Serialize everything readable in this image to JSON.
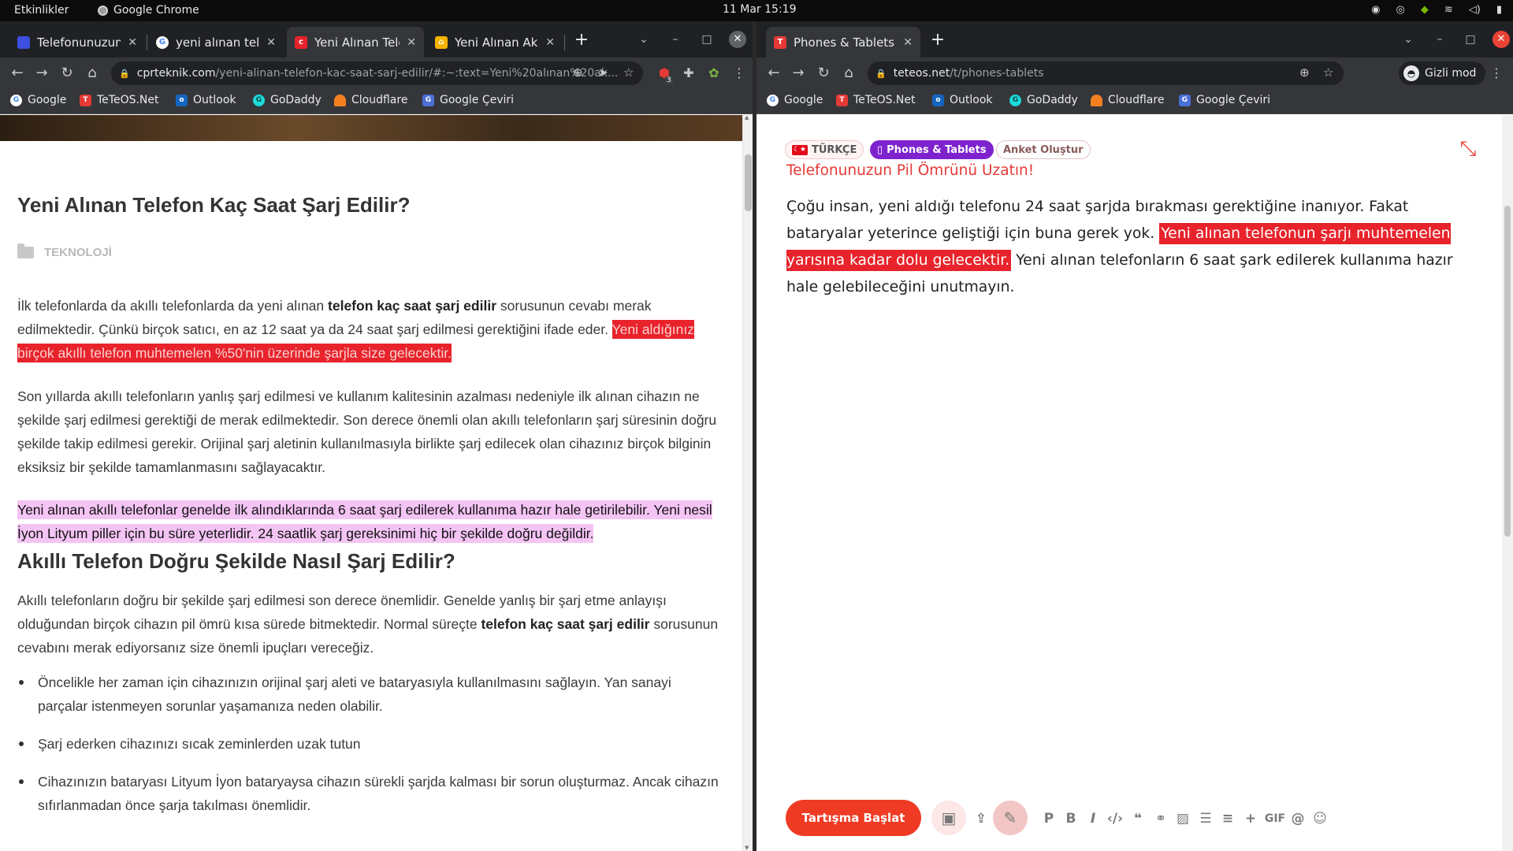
{
  "system": {
    "activities": "Etkinlikler",
    "app_name": "Google Chrome",
    "clock": "11 Mar  15:19"
  },
  "left_window": {
    "tabs": [
      {
        "title": "Telefonunuzun P",
        "favicon_color": "#3c4fe0"
      },
      {
        "title": "yeni alınan telefo",
        "favicon_color": "#4285f4"
      },
      {
        "title": "Yeni Alınan Telef",
        "favicon_color": "#e8232b"
      },
      {
        "title": "Yeni Alınan Akıll",
        "favicon_color": "#f4b400"
      }
    ],
    "url_host": "cprteknik.com",
    "url_path": "/yeni-alinan-telefon-kac-saat-sarj-edilir/#:~:text=Yeni%20alınan%20ak...",
    "extension_badge": "3",
    "article": {
      "title": "Yeni Alınan Telefon Kaç Saat Şarj Edilir?",
      "category": "TEKNOLOJİ",
      "p1_a": "İlk telefonlarda da akıllı telefonlarda da yeni alınan ",
      "p1_bold": "telefon kaç saat şarj edilir",
      "p1_b": " sorusunun cevabı merak edilmektedir. Çünkü birçok satıcı, en az 12 saat ya da 24 saat şarj edilmesi gerektiğini ifade eder. ",
      "p1_highlight": "Yeni aldığınız birçok akıllı telefon muhtemelen %50'nin üzerinde şarjla size gelecektir.",
      "p2": "Son yıllarda akıllı telefonların yanlış şarj edilmesi ve kullanım kalitesinin azalması nedeniyle ilk alınan cihazın ne şekilde şarj edilmesi gerektiği de merak edilmektedir. Son derece önemli olan akıllı telefonların şarj süresinin doğru şekilde takip edilmesi gerekir. Orijinal şarj aletinin kullanılmasıyla birlikte şarj edilecek olan cihazınız birçok bilginin eksiksiz bir şekilde tamamlanmasını sağlayacaktır.",
      "p3_highlight": "Yeni alınan akıllı telefonlar genelde ilk alındıklarında 6 saat şarj edilerek kullanıma hazır hale getirilebilir. Yeni nesil İyon Lityum piller için bu süre yeterlidir. 24 saatlik şarj gereksinimi hiç bir şekilde doğru değildir.",
      "subtitle": "Akıllı Telefon Doğru Şekilde Nasıl Şarj Edilir?",
      "p4_a": "Akıllı telefonların doğru bir şekilde şarj edilmesi son derece önemlidir. Genelde yanlış bir şarj etme anlayışı olduğundan birçok cihazın pil ömrü kısa sürede bitmektedir. Normal süreçte ",
      "p4_bold": "telefon kaç saat şarj edilir",
      "p4_b": " sorusunun cevabını merak ediyorsanız size önemli ipuçları vereceğiz.",
      "bullets": [
        "Öncelikle her zaman için cihazınızın orijinal şarj aleti ve bataryasıyla kullanılmasını sağlayın. Yan sanayi parçalar istenmeyen sorunlar yaşamanıza neden olabilir.",
        "Şarj ederken cihazınızı sıcak zeminlerden uzak tutun",
        "Cihazınızın bataryası Lityum İyon bataryaysa cihazın sürekli şarjda kalması bir sorun oluşturmaz. Ancak cihazın sıfırlanmadan önce şarja takılması önemlidir."
      ]
    }
  },
  "right_window": {
    "tab_title": "Phones & Tablets - TeTeO",
    "url_host": "teteos.net",
    "url_path": "/t/phones-tablets",
    "incognito_label": "Gizli mod",
    "post": {
      "lang_tag": "TÜRKÇE",
      "category_tag": "Phones & Tablets",
      "poll_button": "Anket Oluştur",
      "title": "Telefonunuzun Pil Ömrünü Uzatın!",
      "body_a": "Çoğu insan, yeni aldığı telefonu 24 saat şarjda bırakması gerektiğine inanıyor. Fakat bataryalar yeterince geliştiği için buna gerek yok. ",
      "body_highlight": "Yeni alınan telefonun şarjı muhtemelen yarısına kadar dolu gelecektir.",
      "body_b": " Yeni alınan telefonların 6 saat şark edilerek kullanıma hazır hale gelebileceğini unutmayın."
    },
    "composer": {
      "start_button": "Tartışma Başlat",
      "format_p": "P",
      "format_b": "B",
      "format_i": "I",
      "format_gif": "GIF"
    }
  },
  "bookmarks": [
    {
      "label": "Google",
      "icon": "google-icon"
    },
    {
      "label": "TeTeOS.Net",
      "icon": "teteos-icon"
    },
    {
      "label": "Outlook",
      "icon": "outlook-icon"
    },
    {
      "label": "GoDaddy",
      "icon": "godaddy-icon"
    },
    {
      "label": "Cloudflare",
      "icon": "cloudflare-icon"
    },
    {
      "label": "Google Çeviri",
      "icon": "translate-icon"
    }
  ],
  "colors": {
    "highlight_red": "#e8232b",
    "highlight_pink": "#f4c4f4",
    "accent_orange": "#ef3b24",
    "category_purple": "#7e22ce"
  }
}
